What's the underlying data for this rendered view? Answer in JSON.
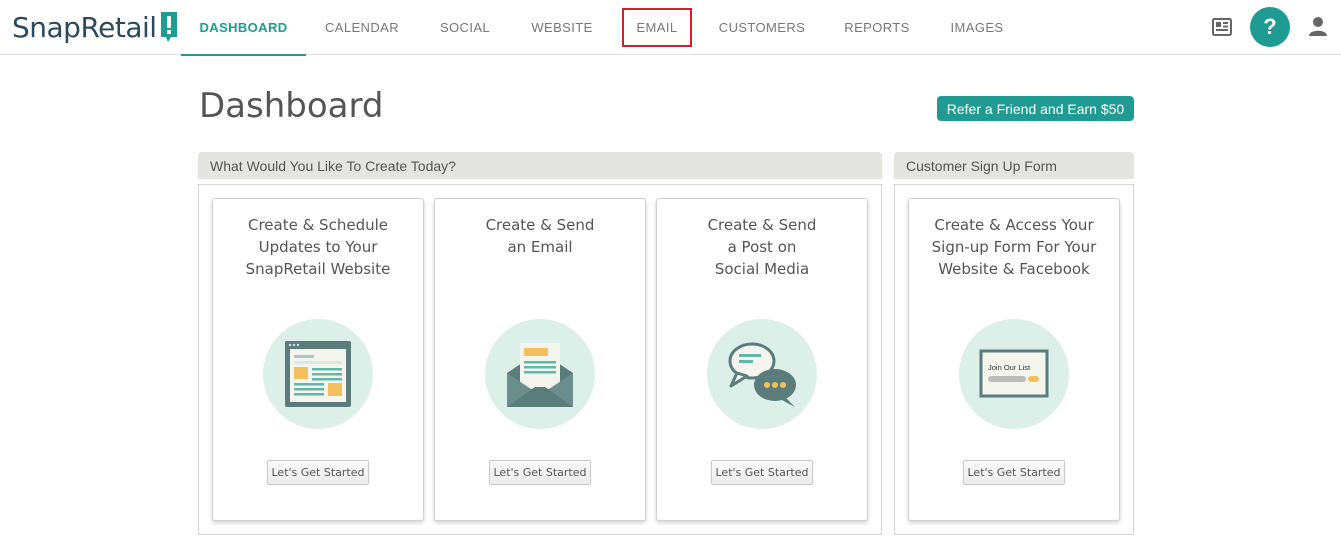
{
  "brand": {
    "name": "SnapRetail",
    "accent": "#1e9c93",
    "highlight": "#d0222a"
  },
  "nav": {
    "items": [
      {
        "label": "DASHBOARD",
        "active": true
      },
      {
        "label": "CALENDAR"
      },
      {
        "label": "SOCIAL"
      },
      {
        "label": "WEBSITE"
      },
      {
        "label": "EMAIL",
        "highlighted": true
      },
      {
        "label": "CUSTOMERS"
      },
      {
        "label": "REPORTS"
      },
      {
        "label": "IMAGES"
      }
    ],
    "icons": [
      "news-icon",
      "help-icon",
      "account-icon"
    ],
    "help_label": "?"
  },
  "page": {
    "title": "Dashboard",
    "refer_label": "Refer a Friend and Earn $50"
  },
  "create_section": {
    "heading": "What Would You Like To Create Today?",
    "cards": [
      {
        "title": "Create & Schedule\nUpdates to Your\nSnapRetail Website",
        "icon": "website-icon",
        "button": "Let's Get Started"
      },
      {
        "title": "Create & Send\nan Email",
        "icon": "email-envelope-icon",
        "button": "Let's Get Started"
      },
      {
        "title": "Create & Send\na Post on\nSocial Media",
        "icon": "chat-bubbles-icon",
        "button": "Let's Get Started"
      }
    ]
  },
  "signup_section": {
    "heading": "Customer Sign Up Form",
    "card": {
      "title": "Create & Access Your\nSign-up Form For Your\nWebsite & Facebook",
      "icon": "signup-form-icon",
      "form_label": "Join Our List",
      "button": "Let's Get Started"
    }
  }
}
